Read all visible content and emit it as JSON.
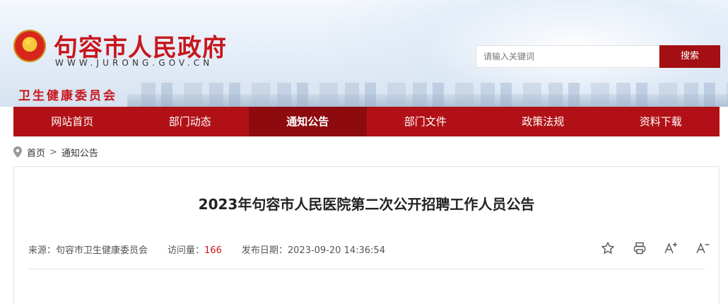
{
  "header": {
    "title": "句容市人民政府",
    "domain": "WWW.JURONG.GOV.CN",
    "department": "卫生健康委员会"
  },
  "search": {
    "placeholder": "请输入关键词",
    "button_label": "搜索"
  },
  "nav": {
    "items": [
      {
        "label": "网站首页"
      },
      {
        "label": "部门动态"
      },
      {
        "label": "通知公告"
      },
      {
        "label": "部门文件"
      },
      {
        "label": "政策法规"
      },
      {
        "label": "资料下载"
      }
    ],
    "active_index": 2,
    "bar_color": "#b11116",
    "active_color": "#8d0b0f"
  },
  "breadcrumb": {
    "home": "首页",
    "separator": ">",
    "current": "通知公告"
  },
  "article": {
    "title": "2023年句容市人民医院第二次公开招聘工作人员公告",
    "source_label": "来源：",
    "source": "句容市卫生健康委员会",
    "views_label": "访问量：",
    "views": "166",
    "date_label": "发布日期：",
    "date": "2023-09-20 14:36:54"
  },
  "tools": [
    {
      "icon": "star-icon"
    },
    {
      "icon": "print-icon"
    },
    {
      "icon": "font-increase-icon"
    },
    {
      "icon": "font-decrease-icon"
    }
  ]
}
